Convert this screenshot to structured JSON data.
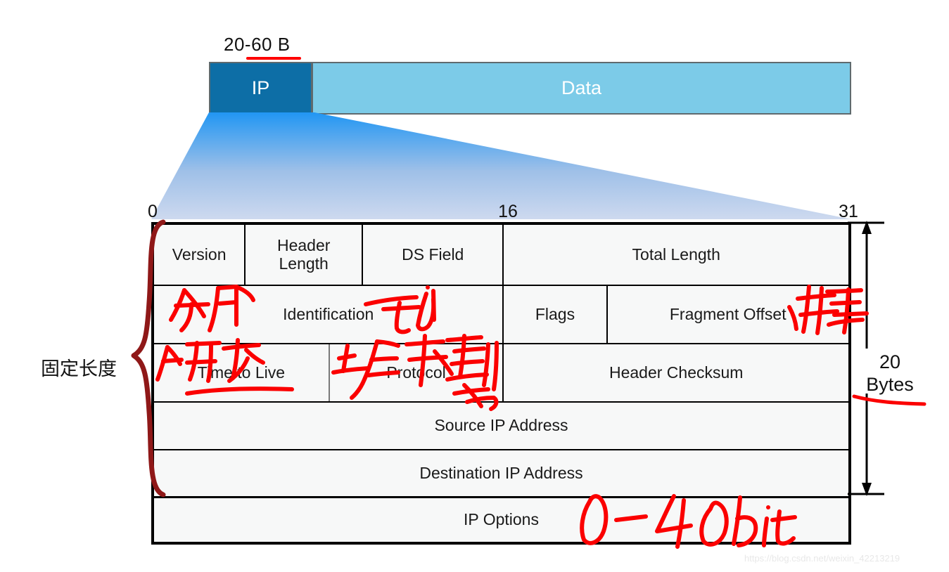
{
  "packet": {
    "length_caption": "20-60 B",
    "ip_label": "IP",
    "data_label": "Data",
    "ip_color": "#0d6ea6",
    "data_color": "#7ccbe8",
    "border_color": "#5f6a6e"
  },
  "ruler": {
    "start_bit": "0",
    "mid_bit": "16",
    "end_bit": "31"
  },
  "header_table": {
    "rows": [
      {
        "cells": [
          {
            "label": "Version",
            "width_pct": 13.2
          },
          {
            "label": "Header\nLength",
            "width_pct": 16.9
          },
          {
            "label": "DS Field",
            "width_pct": 20.3
          },
          {
            "label": "Total Length",
            "width_pct": 49.6
          }
        ]
      },
      {
        "cells": [
          {
            "label": "Identification",
            "width_pct": 50.4
          },
          {
            "label": "Flags",
            "width_pct": 14.9
          },
          {
            "label": "Fragment Offset",
            "width_pct": 34.7
          }
        ]
      },
      {
        "cells": [
          {
            "label": "Time to Live",
            "width_pct": 25.3
          },
          {
            "label": "Protocol",
            "width_pct": 25.1
          },
          {
            "label": "Header Checksum",
            "width_pct": 49.6
          }
        ]
      },
      {
        "cells": [
          {
            "label": "Source IP Address",
            "width_pct": 100
          }
        ]
      },
      {
        "cells": [
          {
            "label": "Destination IP Address",
            "width_pct": 100
          }
        ]
      },
      {
        "cells": [
          {
            "label": "IP  Options",
            "width_pct": 100
          }
        ]
      }
    ]
  },
  "annotations": {
    "fixed_length_label": "固定长度",
    "size_label": "20\nBytes",
    "handwriting_color": "#fb0000",
    "brace_color": "#8f1818",
    "notes": [
      {
        "name": "fragment-note",
        "text": "分片",
        "near": "Identification"
      },
      {
        "name": "id-note",
        "text": "id",
        "near": "Identification"
      },
      {
        "name": "sort-note",
        "text": "排序",
        "near": "Fragment Offset"
      },
      {
        "name": "anti-loop-note",
        "text": "防环",
        "near": "Time to Live"
      },
      {
        "name": "upper-encap-note",
        "text": "上层封装",
        "near": "Protocol"
      },
      {
        "name": "distinguish-note",
        "text": "别之",
        "near": "Protocol"
      },
      {
        "name": "options-size-note",
        "text": "0—40 bit",
        "near": "IP  Options"
      }
    ]
  },
  "watermark": {
    "text": "https://blog.csdn.net/weixin_42213219"
  }
}
